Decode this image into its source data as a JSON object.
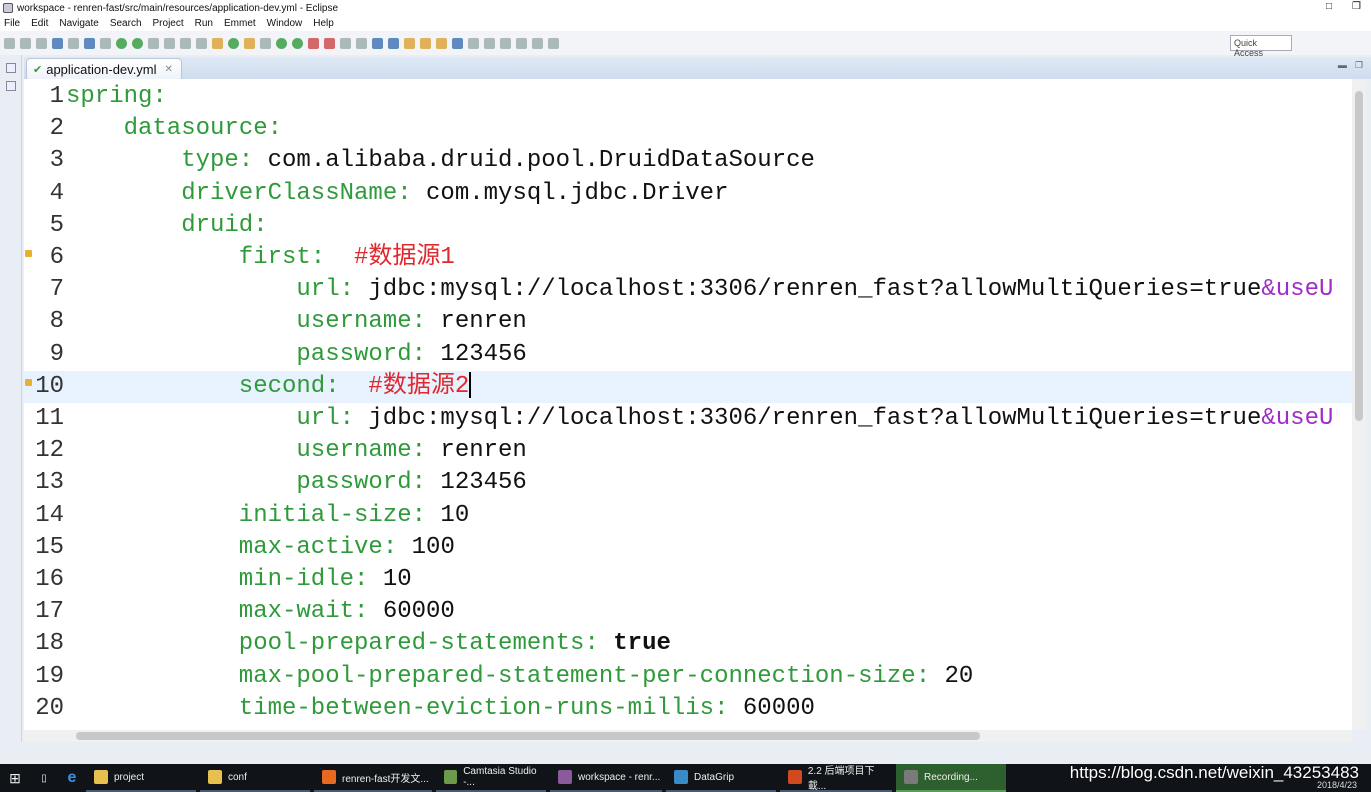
{
  "window": {
    "title": "workspace - renren-fast/src/main/resources/application-dev.yml - Eclipse",
    "controls": [
      "□",
      "❒"
    ]
  },
  "menu": [
    "File",
    "Edit",
    "Navigate",
    "Search",
    "Project",
    "Run",
    "Emmet",
    "Window",
    "Help"
  ],
  "toolbar": {
    "quick_access": "Quick Access"
  },
  "editor": {
    "tab_label": "application-dev.yml",
    "current_line": 10,
    "lines": [
      {
        "n": "1",
        "indent": 0,
        "seg": [
          [
            "k",
            "spring:"
          ]
        ]
      },
      {
        "n": "2",
        "indent": 1,
        "seg": [
          [
            "k",
            "datasource:"
          ]
        ]
      },
      {
        "n": "3",
        "indent": 2,
        "seg": [
          [
            "k",
            "type:"
          ],
          [
            "v",
            " com.alibaba.druid.pool.DruidDataSource"
          ]
        ]
      },
      {
        "n": "4",
        "indent": 2,
        "seg": [
          [
            "k",
            "driverClassName:"
          ],
          [
            "v",
            " com.mysql.jdbc.Driver"
          ]
        ]
      },
      {
        "n": "5",
        "indent": 2,
        "seg": [
          [
            "k",
            "druid:"
          ]
        ]
      },
      {
        "n": "6",
        "indent": 3,
        "mark": true,
        "seg": [
          [
            "k",
            "first:"
          ],
          [
            "c",
            "  #数据源1"
          ]
        ]
      },
      {
        "n": "7",
        "indent": 4,
        "seg": [
          [
            "k",
            "url:"
          ],
          [
            "v",
            " jdbc:mysql://localhost:3306/renren_fast?allowMultiQueries=true"
          ],
          [
            "p",
            "&useU"
          ]
        ]
      },
      {
        "n": "8",
        "indent": 4,
        "seg": [
          [
            "k",
            "username:"
          ],
          [
            "v",
            " renren"
          ]
        ]
      },
      {
        "n": "9",
        "indent": 4,
        "seg": [
          [
            "k",
            "password:"
          ],
          [
            "v",
            " 123456"
          ]
        ]
      },
      {
        "n": "10",
        "indent": 3,
        "mark": true,
        "seg": [
          [
            "k",
            "second:"
          ],
          [
            "c",
            "  #数据源2"
          ]
        ]
      },
      {
        "n": "11",
        "indent": 4,
        "seg": [
          [
            "k",
            "url:"
          ],
          [
            "v",
            " jdbc:mysql://localhost:3306/renren_fast?allowMultiQueries=true"
          ],
          [
            "p",
            "&useU"
          ]
        ]
      },
      {
        "n": "12",
        "indent": 4,
        "seg": [
          [
            "k",
            "username:"
          ],
          [
            "v",
            " renren"
          ]
        ]
      },
      {
        "n": "13",
        "indent": 4,
        "seg": [
          [
            "k",
            "password:"
          ],
          [
            "v",
            " 123456"
          ]
        ]
      },
      {
        "n": "14",
        "indent": 3,
        "seg": [
          [
            "k",
            "initial-size:"
          ],
          [
            "v",
            " 10"
          ]
        ]
      },
      {
        "n": "15",
        "indent": 3,
        "seg": [
          [
            "k",
            "max-active:"
          ],
          [
            "v",
            " 100"
          ]
        ]
      },
      {
        "n": "16",
        "indent": 3,
        "seg": [
          [
            "k",
            "min-idle:"
          ],
          [
            "v",
            " 10"
          ]
        ]
      },
      {
        "n": "17",
        "indent": 3,
        "seg": [
          [
            "k",
            "max-wait:"
          ],
          [
            "v",
            " 60000"
          ]
        ]
      },
      {
        "n": "18",
        "indent": 3,
        "seg": [
          [
            "k",
            "pool-prepared-statements:"
          ],
          [
            "v",
            " "
          ],
          [
            "b",
            "true"
          ]
        ]
      },
      {
        "n": "19",
        "indent": 3,
        "seg": [
          [
            "k",
            "max-pool-prepared-statement-per-connection-size:"
          ],
          [
            "v",
            " 20"
          ]
        ]
      },
      {
        "n": "20",
        "indent": 3,
        "seg": [
          [
            "k",
            "time-between-eviction-runs-millis:"
          ],
          [
            "v",
            " 60000"
          ]
        ]
      }
    ]
  },
  "taskbar": {
    "items": [
      {
        "label": "project",
        "color": "#e8c050"
      },
      {
        "label": "conf",
        "color": "#e8c050"
      },
      {
        "label": "renren-fast开发文...",
        "color": "#e86a20"
      },
      {
        "label": "Camtasia Studio -...",
        "color": "#6a9a4a"
      },
      {
        "label": "workspace - renr...",
        "color": "#8a5a9a"
      },
      {
        "label": "DataGrip",
        "color": "#3a8ac8"
      },
      {
        "label": "2.2 后端项目下載...",
        "color": "#d04a20"
      },
      {
        "label": "Recording...",
        "color": "#7a7a7a",
        "active": true
      }
    ],
    "watermark": "https://blog.csdn.net/weixin_43253483",
    "date": "2018/4/23"
  }
}
